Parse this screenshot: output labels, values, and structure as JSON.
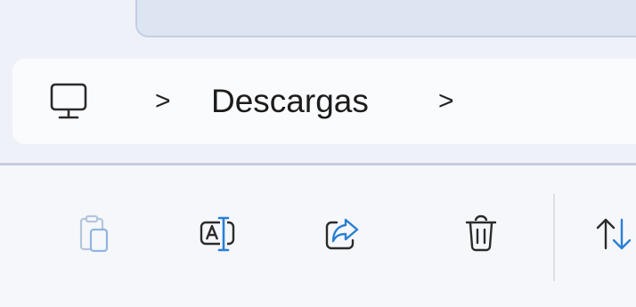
{
  "breadcrumb": {
    "root_icon": "computer-icon",
    "separator": ">",
    "items": [
      {
        "label": "Descargas"
      }
    ],
    "trailing_separator": ">"
  },
  "toolbar": {
    "buttons": [
      {
        "name": "paste",
        "icon": "paste-icon",
        "enabled": false
      },
      {
        "name": "rename",
        "icon": "rename-icon",
        "enabled": true
      },
      {
        "name": "share",
        "icon": "share-icon",
        "enabled": true
      },
      {
        "name": "delete",
        "icon": "trash-icon",
        "enabled": true
      },
      {
        "name": "sort",
        "icon": "sort-icon",
        "enabled": true
      }
    ]
  },
  "colors": {
    "accent": "#2a7fd4",
    "disabled_icon": "#9fbadb",
    "icon": "#2b2b2b"
  }
}
